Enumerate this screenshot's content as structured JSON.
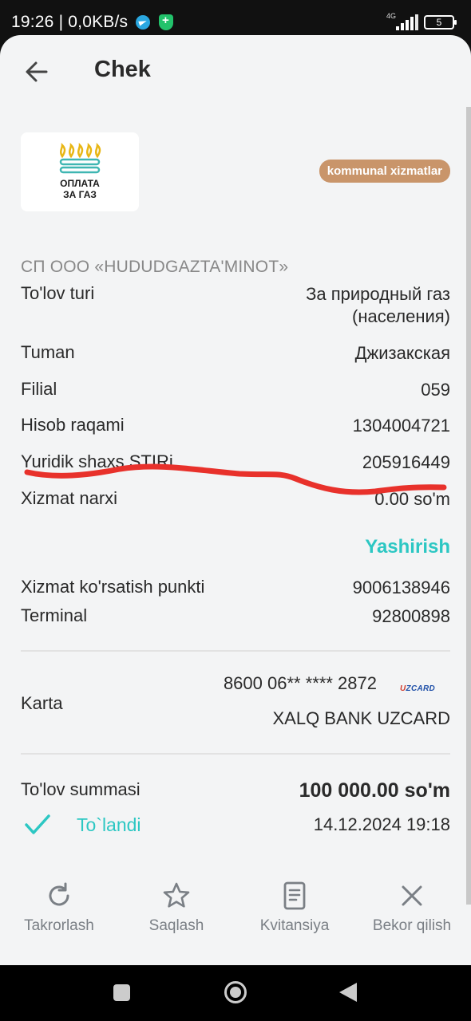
{
  "status_bar": {
    "time": "19:26 | 0,0KB/s",
    "network": "4G",
    "battery": "5"
  },
  "header": {
    "title": "Chek"
  },
  "merchant": {
    "logo_text": "ОПЛАТА\nЗА ГАЗ",
    "category": "kommunal xizmatlar",
    "provider_name": "СП ООО «HUDUDGAZTA'MINOT»"
  },
  "details": [
    {
      "label": "To'lov turi",
      "value": "За природный газ\n(населения)"
    },
    {
      "label": "Tuman",
      "value": "Джизакская"
    },
    {
      "label": "Filial",
      "value": "059"
    },
    {
      "label": "Hisob raqami",
      "value": "1304004721"
    },
    {
      "label": "Yuridik shaxs STIRi",
      "value": "205916449"
    },
    {
      "label": "Xizmat narxi",
      "value": "0.00 so'm"
    }
  ],
  "hide_link": "Yashirish",
  "service": [
    {
      "label": "Xizmat ko'rsatish punkti",
      "value": "9006138946"
    },
    {
      "label": "Terminal",
      "value": "92800898"
    }
  ],
  "card": {
    "label": "Karta",
    "number": "8600 06** **** 2872",
    "bank": "XALQ BANK UZCARD",
    "brand_prefix": "U",
    "brand_rest": "ZCARD"
  },
  "payment": {
    "label": "To'lov summasi",
    "amount": "100 000.00 so'm",
    "status": "To`landi",
    "date": "14.12.2024 19:18"
  },
  "actions": [
    {
      "label": "Takrorlash",
      "icon": "repeat-icon"
    },
    {
      "label": "Saqlash",
      "icon": "star-icon"
    },
    {
      "label": "Kvitansiya",
      "icon": "receipt-icon"
    },
    {
      "label": "Bekor qilish",
      "icon": "close-icon"
    }
  ],
  "colors": {
    "accent": "#2cc7c3",
    "badge": "#c9956a",
    "scribble": "#e8312b"
  }
}
